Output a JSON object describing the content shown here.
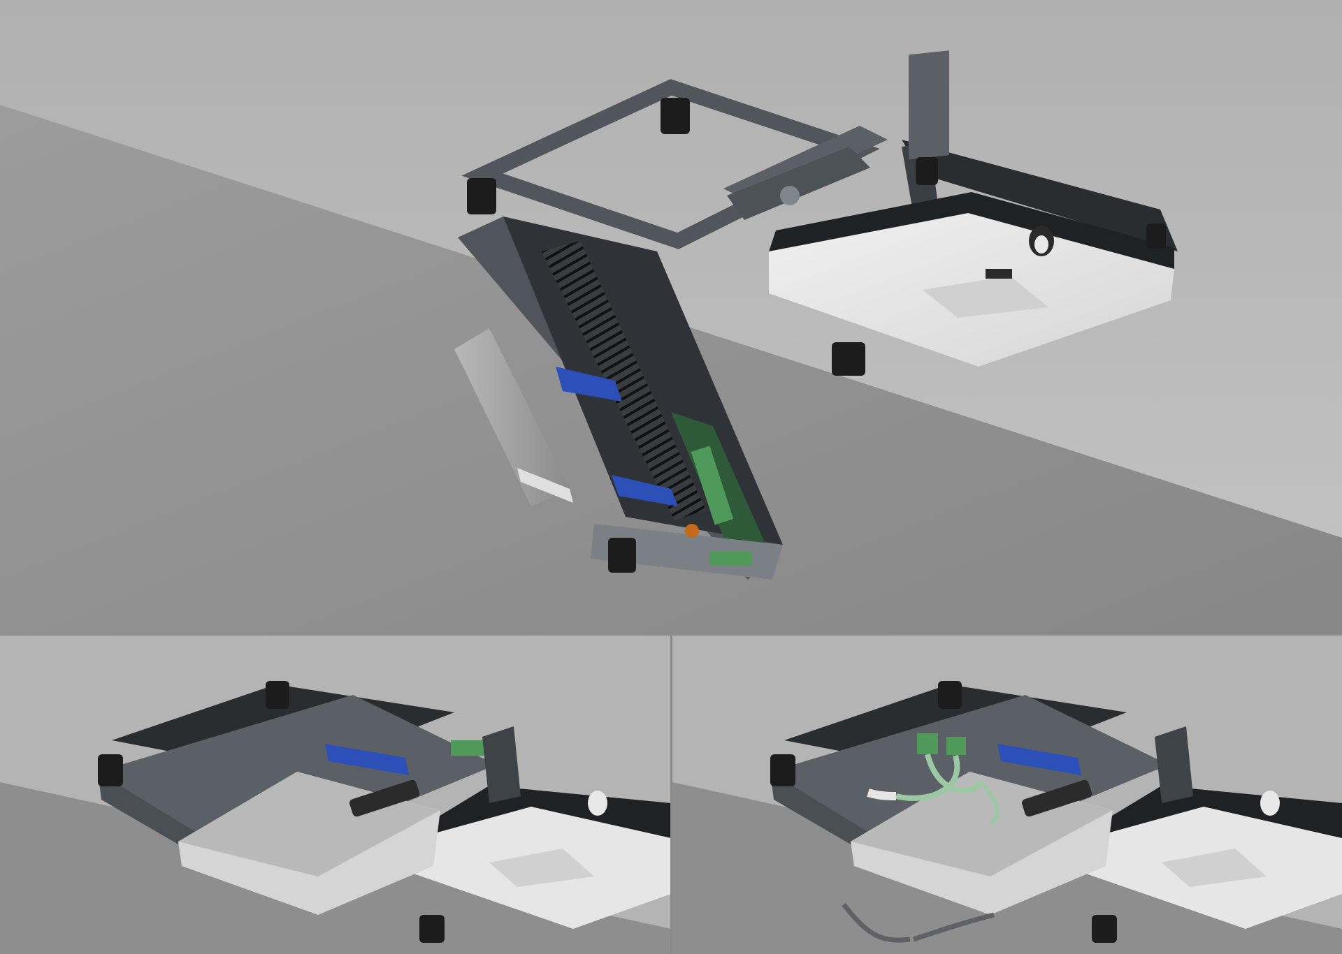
{
  "scene": {
    "description_panels": [
      {
        "name": "exploded-view",
        "state": "bracket-open"
      },
      {
        "name": "assembled-view",
        "state": "bracket-closed"
      },
      {
        "name": "cabled-view",
        "state": "bracket-closed-with-cables"
      }
    ]
  },
  "colors": {
    "ceiling_light": "#b9b9b9",
    "wall": "#8f8f8f",
    "bracket_metal": "#5b6066",
    "bracket_dark": "#2c2f33",
    "device_white": "#e6e6e6",
    "blue_strip": "#2c4fb8",
    "green_terminal": "#4f9a5a",
    "pcb_green": "#2f5a3a",
    "knob_black": "#1c1c1c"
  }
}
